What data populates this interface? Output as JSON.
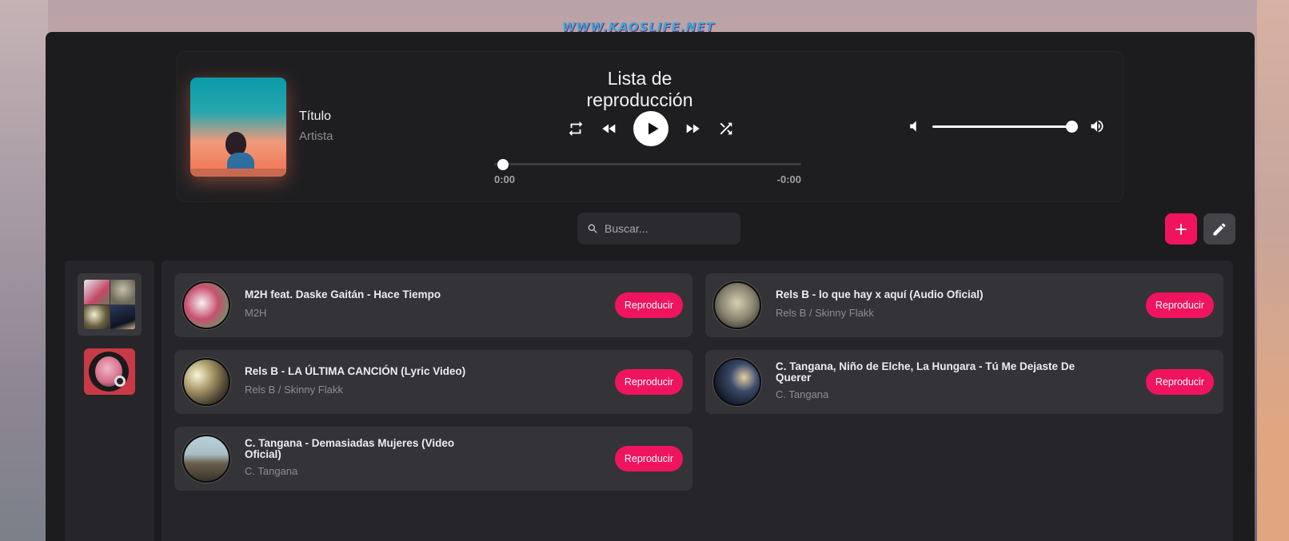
{
  "watermark": "WWW.KAOSLIFE.NET",
  "player": {
    "playlist_title": "Lista de reproducción",
    "track_title": "Título",
    "track_artist": "Artista",
    "time_current": "0:00",
    "time_remaining": "-0:00",
    "progress": 0,
    "volume": 1.0
  },
  "search": {
    "placeholder": "Buscar..."
  },
  "icons": {
    "repeat": "repeat-icon",
    "previous": "rewind-icon",
    "play": "play-icon",
    "next": "fast-forward-icon",
    "shuffle": "shuffle-icon",
    "volume_low": "volume-low-icon",
    "volume_high": "volume-high-icon",
    "search": "search-icon",
    "add": "plus-icon",
    "edit": "pencil-icon"
  },
  "colors": {
    "accent": "#f0145f",
    "background": "#1c1c1f",
    "panel": "#26262a",
    "card": "#343438"
  },
  "songs": [
    {
      "title": "M2H feat. Daske Gaitán - Hace Tiempo",
      "artist": "M2H",
      "button": "Reproducir"
    },
    {
      "title": "Rels B - lo que hay x aquí (Audio Oficial)",
      "artist": "Rels B / Skinny Flakk",
      "button": "Reproducir"
    },
    {
      "title": "Rels B - LA ÚLTIMA CANCIÓN (Lyric Video)",
      "artist": "Rels B / Skinny Flakk",
      "button": "Reproducir"
    },
    {
      "title": "C. Tangana, Niño de Elche, La Hungara - Tú Me Dejaste De Querer",
      "artist": "C. Tangana",
      "button": "Reproducir"
    },
    {
      "title": "C. Tangana - Demasiadas Mujeres (Video Oficial)",
      "artist": "C. Tangana",
      "button": "Reproducir"
    }
  ]
}
